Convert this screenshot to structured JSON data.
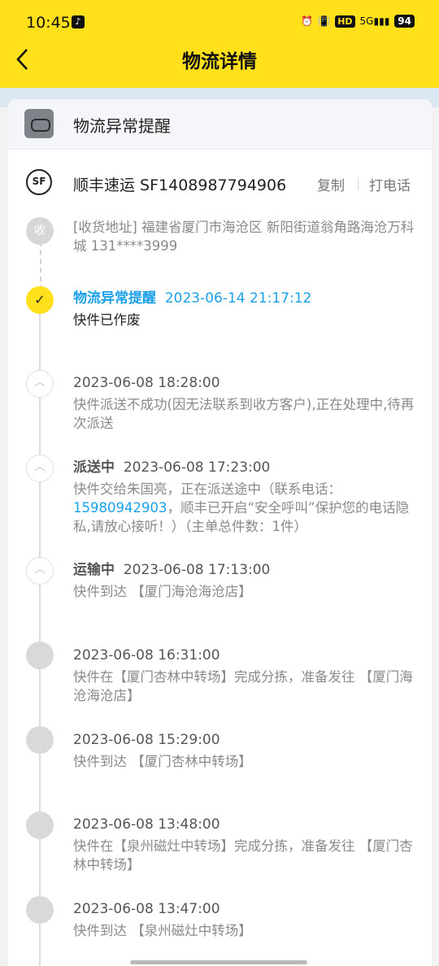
{
  "status_bar": {
    "time": "10:45",
    "network": "5G",
    "hd": "HD",
    "battery": "94"
  },
  "header": {
    "back_icon": "chevron-left-icon",
    "title": "物流详情",
    "bg_color": "#ffe01a"
  },
  "alert": {
    "text": "物流异常提醒"
  },
  "carrier": {
    "logo": "SF",
    "name": "顺丰速运 SF1408987794906",
    "copy_label": "复制",
    "call_label": "打电话"
  },
  "address": {
    "node_label": "收",
    "text": "[收货地址] 福建省厦门市海沧区 新阳街道翁角路海沧万科城 131****3999"
  },
  "timeline": [
    {
      "status": "物流异常提醒",
      "time": "2023-06-14 21:17:12",
      "desc": "快件已作废"
    },
    {
      "status": "",
      "time": "2023-06-08 18:28:00",
      "desc": "快件派送不成功(因无法联系到收方客户),正在处理中,待再次派送"
    },
    {
      "status": "派送中",
      "time": "2023-06-08 17:23:00",
      "desc_pre": "快件交给朱国亮，正在派送途中（联系电话：",
      "phone": "15980942903",
      "desc_post": "，顺丰已开启“安全呼叫”保护您的电话隐私,请放心接听！）（主单总件数：1件）"
    },
    {
      "status": "运输中",
      "time": "2023-06-08 17:13:00",
      "desc": "快件到达 【厦门海沧海沧店】"
    },
    {
      "status": "",
      "time": "2023-06-08 16:31:00",
      "desc": "快件在【厦门杏林中转场】完成分拣，准备发往 【厦门海沧海沧店】"
    },
    {
      "status": "",
      "time": "2023-06-08 15:29:00",
      "desc": "快件到达 【厦门杏林中转场】"
    },
    {
      "status": "",
      "time": "2023-06-08 13:48:00",
      "desc": "快件在【泉州磁灶中转场】完成分拣，准备发往 【厦门杏林中转场】"
    },
    {
      "status": "",
      "time": "2023-06-08 13:47:00",
      "desc": "快件到达 【泉州磁灶中转场】"
    }
  ]
}
